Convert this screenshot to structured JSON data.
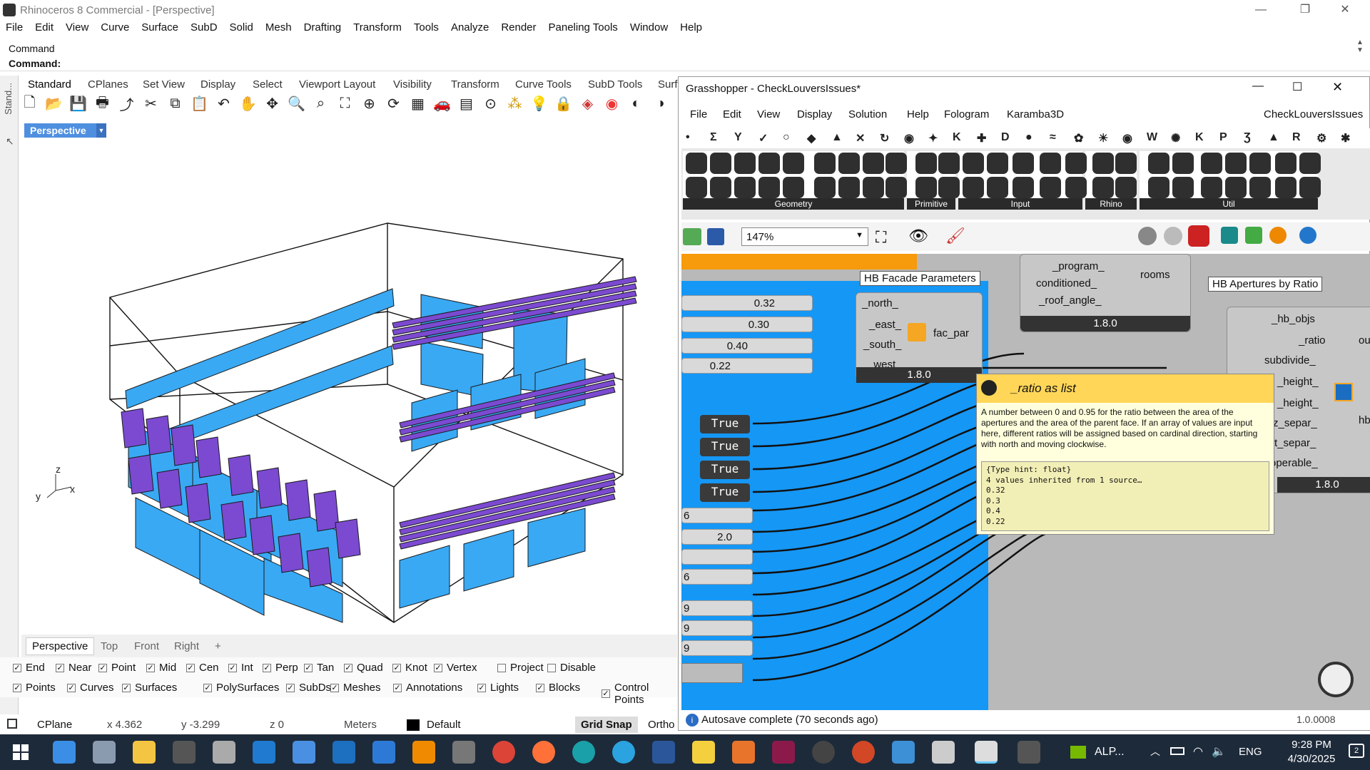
{
  "rhino": {
    "window_title": "Rhinoceros 8 Commercial - [Perspective]",
    "menu": [
      "File",
      "Edit",
      "View",
      "Curve",
      "Surface",
      "SubD",
      "Solid",
      "Mesh",
      "Drafting",
      "Transform",
      "Tools",
      "Analyze",
      "Render",
      "Paneling Tools",
      "Window",
      "Help"
    ],
    "command_history": "Command",
    "command_prompt": "Command:",
    "toolbar_tabs": [
      "Standard",
      "CPlanes",
      "Set View",
      "Display",
      "Select",
      "Viewport Layout",
      "Visibility",
      "Transform",
      "Curve Tools",
      "SubD Tools",
      "Surf"
    ],
    "side_tab": "Stand...",
    "viewport_title": "Perspective",
    "viewport_tabs": [
      "Perspective",
      "Top",
      "Front",
      "Right",
      "+"
    ],
    "axis_labels": {
      "x": "x",
      "y": "y",
      "z": "z"
    },
    "osnaps": [
      {
        "label": "End",
        "checked": true
      },
      {
        "label": "Near",
        "checked": true
      },
      {
        "label": "Point",
        "checked": true
      },
      {
        "label": "Mid",
        "checked": true
      },
      {
        "label": "Cen",
        "checked": true
      },
      {
        "label": "Int",
        "checked": true
      },
      {
        "label": "Perp",
        "checked": true
      },
      {
        "label": "Tan",
        "checked": true
      },
      {
        "label": "Quad",
        "checked": true
      },
      {
        "label": "Knot",
        "checked": true
      },
      {
        "label": "Vertex",
        "checked": true
      },
      {
        "label": "Project",
        "checked": false
      },
      {
        "label": "Disable",
        "checked": false
      }
    ],
    "filters": [
      {
        "label": "Points",
        "checked": true
      },
      {
        "label": "Curves",
        "checked": true
      },
      {
        "label": "Surfaces",
        "checked": true
      },
      {
        "label": "PolySurfaces",
        "checked": true
      },
      {
        "label": "SubDs",
        "checked": true
      },
      {
        "label": "Meshes",
        "checked": true
      },
      {
        "label": "Annotations",
        "checked": true
      },
      {
        "label": "Lights",
        "checked": true
      },
      {
        "label": "Blocks",
        "checked": true
      },
      {
        "label": "Control Points",
        "checked": true
      },
      {
        "label": "Po",
        "checked": true
      }
    ],
    "status": {
      "cplane": "CPlane",
      "x": "x 4.362",
      "y": "y -3.299",
      "z": "z 0",
      "units": "Meters",
      "layer": "Default",
      "grid_snap": "Grid Snap",
      "ortho": "Ortho"
    }
  },
  "gh": {
    "title": "Grasshopper - CheckLouversIssues*",
    "menu": [
      "File",
      "Edit",
      "View",
      "Display",
      "Solution",
      "Help",
      "Fologram",
      "Karamba3D"
    ],
    "doc_name": "CheckLouversIssues",
    "tab_icons": [
      "•",
      "Σ",
      "Y",
      "✓",
      "○",
      "◆",
      "▲",
      "✕",
      "↻",
      "◉",
      "✦",
      "K",
      "✚",
      "D",
      "●",
      "≈",
      "✿",
      "☀",
      "◉",
      "W",
      "✺",
      "K",
      "P",
      "Ʒ",
      "▲",
      "R",
      "⚙",
      "✱"
    ],
    "ribbon_groups": [
      "Geometry",
      "Primitive",
      "Input",
      "Rhino",
      "Util"
    ],
    "zoom": "147%",
    "facade_group_label": "HB Facade Parameters",
    "sliders": [
      "0.32",
      "0.30",
      "0.40",
      "0.22"
    ],
    "facade_inputs": [
      "_north_",
      "_east_",
      "_south_",
      "_west_"
    ],
    "facade_output": "fac_par",
    "facade_version": "1.8.0",
    "toggles": [
      "True",
      "True",
      "True",
      "True"
    ],
    "lower_sliders": [
      "6",
      "2.0",
      "",
      "6"
    ],
    "bottom_sliders": [
      "9",
      "9",
      "9"
    ],
    "room_inputs": [
      "_program_",
      "conditioned_",
      "_roof_angle_"
    ],
    "room_output": "rooms",
    "room_version": "1.8.0",
    "apertures_label": "HB Apertures by Ratio",
    "aperture_inputs": [
      "_hb_objs",
      "_ratio",
      "subdivide_",
      "_height_",
      "_height_",
      "z_separ_",
      "t_separ_",
      "operable_"
    ],
    "aperture_output": "ou",
    "aperture_side": "hb",
    "aperture_version": "1.8.0",
    "tooltip": {
      "title": "_ratio as list",
      "description": "A number between 0 and 0.95 for the ratio between the area of the apertures and the area of the parent face. If an array of values are input here, different ratios will be assigned based on cardinal direction, starting with north and moving clockwise.",
      "code_lines": [
        "{Type hint: float}",
        "4 values inherited from 1 source…",
        "0.32",
        "0.3",
        "0.4",
        "0.22"
      ]
    },
    "status": "Autosave complete (70 seconds ago)",
    "version": "1.0.0008"
  },
  "taskbar": {
    "tray_app": "ALP...",
    "lang": "ENG",
    "time": "9:28 PM",
    "date": "4/30/2025",
    "notif": "2"
  }
}
